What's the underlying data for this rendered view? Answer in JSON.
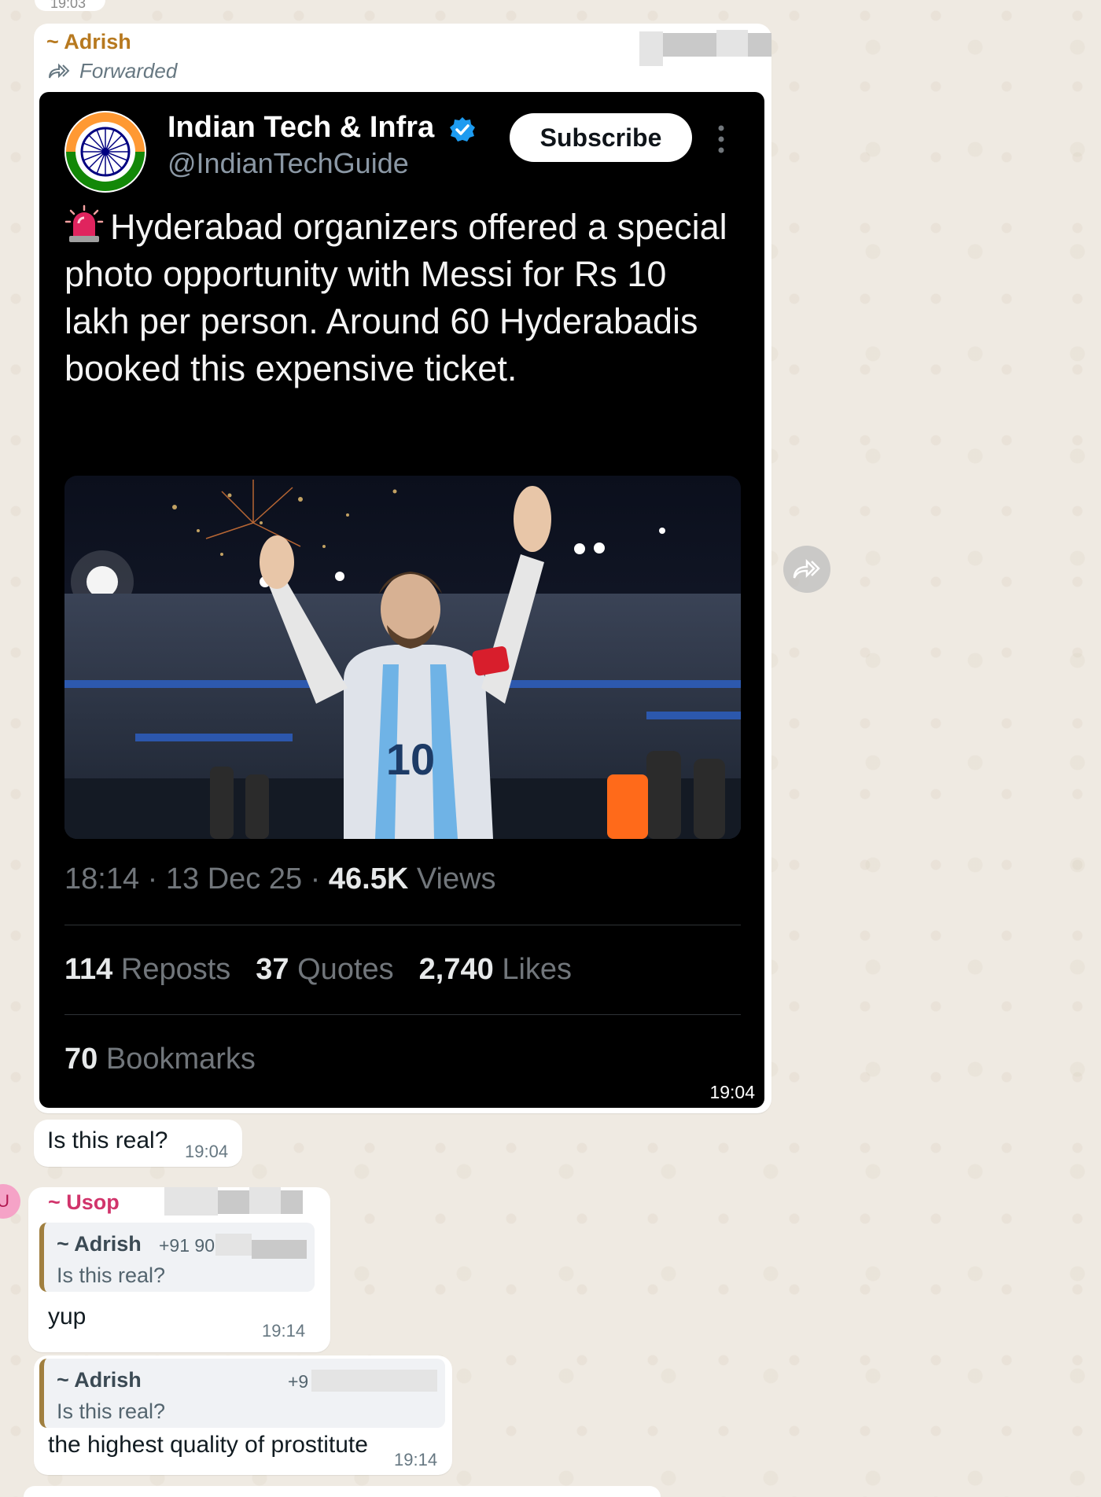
{
  "chat": {
    "previous_time": "19:03",
    "messages": [
      {
        "sender": "~ Adrish",
        "sender_color": "#b7791f",
        "forwarded_label": "Forwarded",
        "time": "19:04",
        "tweet": {
          "account_name": "Indian Tech & Infra",
          "account_handle": "@IndianTechGuide",
          "verified": true,
          "subscribe_label": "Subscribe",
          "emoji": "siren-icon",
          "text": "Hyderabad organizers offered a special photo opportunity with Messi for Rs 10 lakh per person. Around 60 Hyderabadis booked this expensive ticket.",
          "post_time": "18:14",
          "post_date": "13 Dec 25",
          "views_count": "46.5K",
          "views_label": "Views",
          "reposts_count": "114",
          "reposts_label": "Reposts",
          "quotes_count": "37",
          "quotes_label": "Quotes",
          "likes_count": "2,740",
          "likes_label": "Likes",
          "bookmarks_count": "70",
          "bookmarks_label": "Bookmarks",
          "photo_jersey_number": "10"
        }
      },
      {
        "text": "Is this real?",
        "time": "19:04"
      },
      {
        "sender": "~ Usop",
        "sender_color": "#d1346b",
        "avatar_initial": "U",
        "quoted": {
          "sender": "~ Adrish",
          "phone": "+91 90",
          "text": "Is this real?"
        },
        "text": "yup",
        "time": "19:14"
      },
      {
        "quoted": {
          "sender": "~ Adrish",
          "phone": "+9",
          "text": "Is this real?"
        },
        "text": "the highest quality of prostitute",
        "time": "19:14"
      }
    ]
  },
  "colors": {
    "chat_background": "#efeae2",
    "bubble": "#ffffff",
    "tweet_background": "#000000",
    "verified_blue": "#1d9bf0",
    "quote_bar": "#a07f3f"
  }
}
